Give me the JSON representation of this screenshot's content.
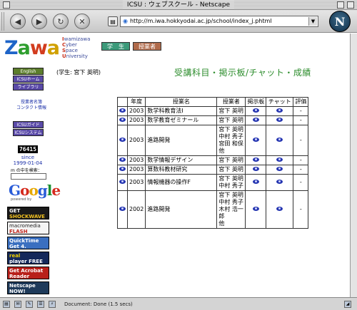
{
  "window": {
    "title": "ICSU : ウェブスクール - Netscape"
  },
  "toolbar": {
    "url": "http://m.iwa.hokkyodai.ac.jp/school/index_j.phtml",
    "brand": "N"
  },
  "status": {
    "text": "Document: Done (1.5 secs)"
  },
  "header": {
    "logo": {
      "z": "Z",
      "a1": "a",
      "w": "w",
      "a2": "a"
    },
    "tagline": [
      {
        "cap": "I",
        "rest": "wamizawa"
      },
      {
        "cap": "C",
        "rest": "yber"
      },
      {
        "cap": "S",
        "rest": "pace"
      },
      {
        "cap": "U",
        "rest": "niversity"
      }
    ],
    "nav": [
      {
        "label": "学　生"
      },
      {
        "label": "授業者"
      }
    ]
  },
  "sidebar": {
    "buttons": [
      {
        "label": "English"
      },
      {
        "label": "ICSUホーム"
      },
      {
        "label": "ライブラリ"
      }
    ],
    "contact": [
      "授業者名簿",
      "コンタクト情報"
    ],
    "guides": [
      {
        "label": "ICSUガイド"
      },
      {
        "label": "ICSUシステム"
      }
    ],
    "counter": "76415",
    "since": [
      "since",
      "1999-01-04"
    ],
    "search_label": "m の中を検索：",
    "google": {
      "g1": "G",
      "o1": "o",
      "o2": "o",
      "g2": "g",
      "l": "l",
      "e": "e",
      "powered": "powered by"
    },
    "badges": [
      {
        "line1": "GET",
        "line2": "SHOCKWAVE"
      },
      {
        "line1": "macromedia",
        "line2": "FLASH PLAYER"
      },
      {
        "line1": "QuickTime",
        "line2": "Get 4."
      },
      {
        "line1": "real",
        "line2": "player FREE"
      },
      {
        "line1": "Get Acrobat",
        "line2": "Reader"
      },
      {
        "line1": "Netscape",
        "line2": "NOW!"
      }
    ]
  },
  "main": {
    "student": "(学生: 宮下 英明)",
    "heading": "受講科目・掲示板/チャット・成績",
    "table": {
      "headers": [
        "",
        "年度",
        "授業名",
        "授業者",
        "掲示板",
        "チャット",
        "評価"
      ],
      "rows": [
        {
          "year": "2003",
          "name": "数学科教育法Ⅰ",
          "teachers": [
            "宮下 英明"
          ],
          "eval": "-"
        },
        {
          "year": "2003",
          "name": "数学教育ゼミナール",
          "teachers": [
            "宮下 英明"
          ],
          "eval": "-"
        },
        {
          "year": "2003",
          "name": "進路開発",
          "teachers": [
            "宮下 英明",
            "中村 秀子",
            "宮田 和保",
            "他"
          ],
          "eval": "-"
        },
        {
          "year": "2003",
          "name": "数学情報デザイン",
          "teachers": [
            "宮下 英明"
          ],
          "eval": "-"
        },
        {
          "year": "2003",
          "name": "算数科教材研究",
          "teachers": [
            "宮下 英明"
          ],
          "eval": "-"
        },
        {
          "year": "2003",
          "name": "情報機器の操作F",
          "teachers": [
            "宮下 英明",
            "中村 秀子"
          ],
          "eval": "-"
        },
        {
          "year": "2002",
          "name": "進路開発",
          "teachers": [
            "宮下 英明",
            "中村 秀子",
            "木村 浩一郎",
            "他"
          ],
          "eval": "-"
        }
      ]
    }
  }
}
